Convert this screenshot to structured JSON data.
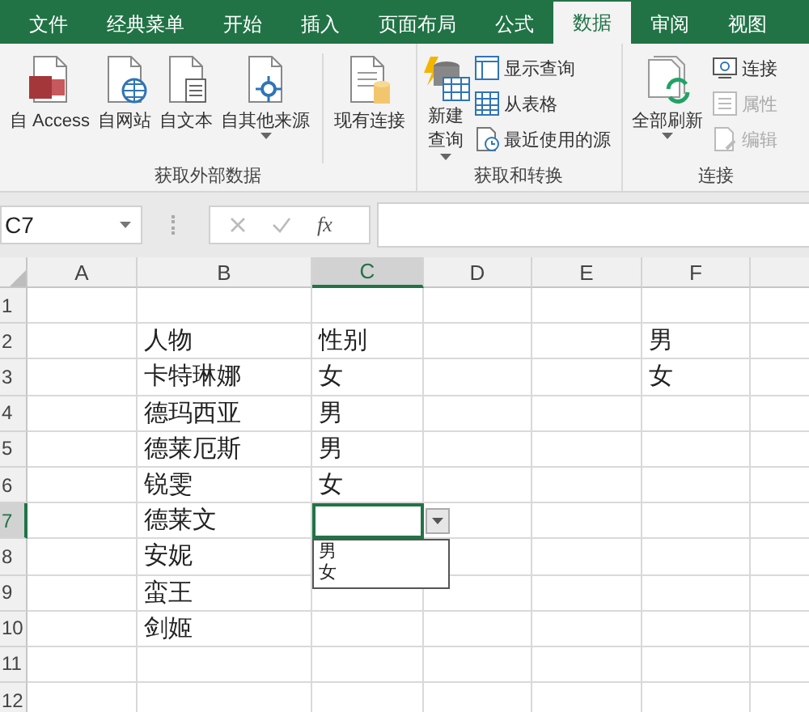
{
  "tabs": [
    {
      "label": "文件",
      "selected": false
    },
    {
      "label": "经典菜单",
      "selected": false
    },
    {
      "label": "开始",
      "selected": false
    },
    {
      "label": "插入",
      "selected": false
    },
    {
      "label": "页面布局",
      "selected": false
    },
    {
      "label": "公式",
      "selected": false
    },
    {
      "label": "数据",
      "selected": true
    },
    {
      "label": "审阅",
      "selected": false
    },
    {
      "label": "视图",
      "selected": false
    }
  ],
  "ribbon": {
    "groups": [
      {
        "label": "获取外部数据",
        "items": [
          {
            "kind": "large",
            "label": "自 Access"
          },
          {
            "kind": "large",
            "label": "自网站"
          },
          {
            "kind": "large",
            "label": "自文本"
          },
          {
            "kind": "large",
            "label": "自其他来源",
            "dropdown": true
          },
          {
            "kind": "large",
            "label": "现有连接",
            "separator_before": true
          }
        ]
      },
      {
        "label": "获取和转换",
        "items": [
          {
            "kind": "large",
            "label": "新建查询",
            "dropdown": true
          },
          {
            "kind": "small",
            "label": "显示查询",
            "disabled": false
          },
          {
            "kind": "small",
            "label": "从表格",
            "disabled": false
          },
          {
            "kind": "small",
            "label": "最近使用的源",
            "disabled": false
          }
        ]
      },
      {
        "label": "连接",
        "items": [
          {
            "kind": "large",
            "label": "全部刷新",
            "dropdown": true
          },
          {
            "kind": "small",
            "label": "连接",
            "disabled": false
          },
          {
            "kind": "small",
            "label": "属性",
            "disabled": true
          },
          {
            "kind": "small",
            "label": "编辑",
            "disabled": true
          }
        ]
      }
    ]
  },
  "formula_bar": {
    "name_box": "C7",
    "function_label": "fx"
  },
  "sheet": {
    "columns": [
      {
        "label": "A",
        "selected": false
      },
      {
        "label": "B",
        "selected": false
      },
      {
        "label": "C",
        "selected": true
      },
      {
        "label": "D",
        "selected": false
      },
      {
        "label": "E",
        "selected": false
      },
      {
        "label": "F",
        "selected": false
      }
    ],
    "rows": [
      {
        "label": "1",
        "selected": false
      },
      {
        "label": "2",
        "selected": false,
        "column_b": "人物",
        "column_c": "性别",
        "column_f": "男"
      },
      {
        "label": "3",
        "selected": false,
        "column_b": "卡特琳娜",
        "column_c": "女",
        "column_f": "女"
      },
      {
        "label": "4",
        "selected": false,
        "column_b": "德玛西亚",
        "column_c": "男"
      },
      {
        "label": "5",
        "selected": false,
        "column_b": "德莱厄斯",
        "column_c": "男"
      },
      {
        "label": "6",
        "selected": false,
        "column_b": "锐雯",
        "column_c": "女"
      },
      {
        "label": "7",
        "selected": true,
        "column_b": "德莱文"
      },
      {
        "label": "8",
        "selected": false,
        "column_b": "安妮"
      },
      {
        "label": "9",
        "selected": false,
        "column_b": "蛮王"
      },
      {
        "label": "10",
        "selected": false,
        "column_b": "剑姬"
      },
      {
        "label": "11",
        "selected": false
      },
      {
        "label": "12",
        "selected": false
      }
    ],
    "validation_list": {
      "options": [
        "男",
        "女"
      ]
    }
  }
}
